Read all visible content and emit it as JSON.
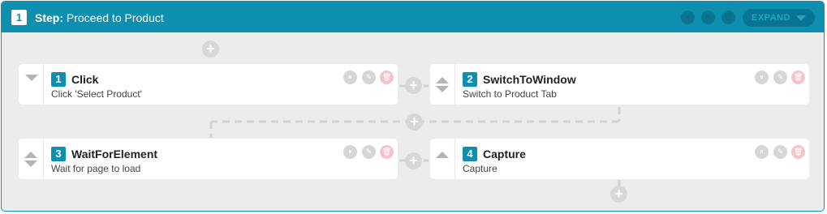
{
  "step": {
    "number": "1",
    "label": "Step:",
    "title": "Proceed to Product"
  },
  "header_actions": {
    "pause_icon": "pause-icon",
    "edit_icon": "pencil-icon",
    "delete_icon": "trash-icon",
    "expand_label": "EXPAND"
  },
  "actions": [
    {
      "number": "1",
      "title": "Click",
      "description": "Click 'Select Product'"
    },
    {
      "number": "2",
      "title": "SwitchToWindow",
      "description": "Switch to Product Tab"
    },
    {
      "number": "3",
      "title": "WaitForElement",
      "description": "Wait for page to load"
    },
    {
      "number": "4",
      "title": "Capture",
      "description": "Capture"
    }
  ],
  "icons": {
    "pause": "⏸",
    "edit": "✎",
    "delete": "🗑",
    "plus": "+"
  },
  "colors": {
    "accent": "#0e8fb0",
    "delete": "#f4c4cc",
    "canvas": "#ececec"
  }
}
